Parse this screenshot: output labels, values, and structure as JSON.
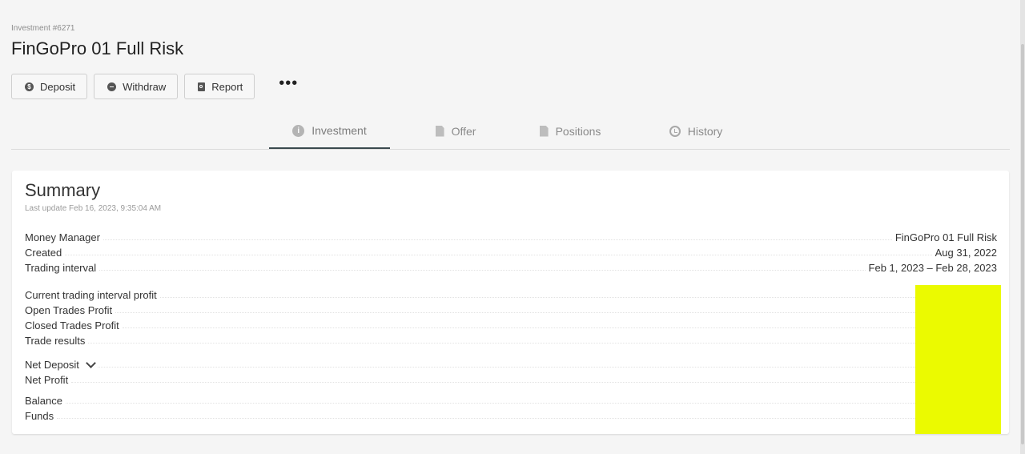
{
  "breadcrumb": "Investment #6271",
  "title": "FinGoPro 01 Full Risk",
  "actions": {
    "deposit": "Deposit",
    "withdraw": "Withdraw",
    "report": "Report",
    "more": "•••"
  },
  "tabs": [
    {
      "label": "Investment",
      "icon": "info-icon",
      "active": true
    },
    {
      "label": "Offer",
      "icon": "file-icon"
    },
    {
      "label": "Positions",
      "icon": "document-icon"
    },
    {
      "label": "History",
      "icon": "history-icon"
    }
  ],
  "summary": {
    "title": "Summary",
    "last_update": "Last update Feb 16, 2023, 9:35:04 AM",
    "info_rows": [
      {
        "label": "Money Manager",
        "value": "FinGoPro 01 Full Risk"
      },
      {
        "label": "Created",
        "value": "Aug 31, 2022"
      },
      {
        "label": "Trading interval",
        "value": "Feb 1, 2023 – Feb 28, 2023"
      }
    ],
    "profit_rows": [
      {
        "label": "Current trading interval profit"
      },
      {
        "label": "Open Trades Profit"
      },
      {
        "label": "Closed Trades Profit"
      },
      {
        "label": "Trade results"
      }
    ],
    "deposit_rows": [
      {
        "label": "Net Deposit"
      },
      {
        "label": "Net Profit"
      }
    ],
    "balance_rows": [
      {
        "label": "Balance"
      },
      {
        "label": "Funds"
      }
    ]
  },
  "colors": {
    "redaction": "#ebfa00",
    "tab_active_underline": "#3b4a4f"
  }
}
